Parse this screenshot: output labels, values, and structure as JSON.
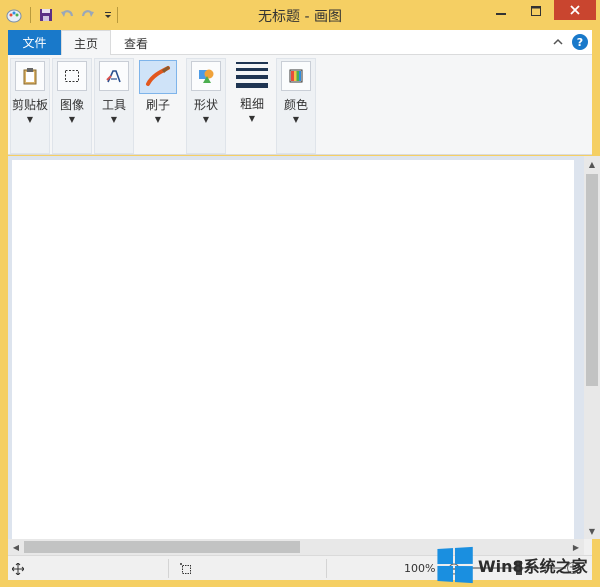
{
  "window": {
    "title": "无标题 - 画图",
    "colors": {
      "frame": "#f5cf63",
      "file_tab": "#1979ca",
      "close": "#c9452f"
    }
  },
  "quick_access": {
    "icons": [
      "paint-app-icon",
      "save-icon",
      "undo-icon",
      "redo-icon",
      "customize-qat-icon"
    ]
  },
  "ribbon": {
    "tabs": [
      {
        "label": "文件"
      },
      {
        "label": "主页"
      },
      {
        "label": "查看"
      }
    ],
    "groups": [
      {
        "label": "剪贴板",
        "icon": "clipboard-icon"
      },
      {
        "label": "图像",
        "icon": "select-icon"
      },
      {
        "label": "工具",
        "icon": "tools-icon"
      },
      {
        "label": "刷子",
        "icon": "brush-icon"
      },
      {
        "label": "形状",
        "icon": "shapes-icon"
      },
      {
        "label": "粗细",
        "icon": "line-size-icon"
      },
      {
        "label": "颜色",
        "icon": "colors-icon"
      }
    ]
  },
  "status": {
    "zoom": "100%"
  },
  "watermark": {
    "text": "Win8系统之家"
  }
}
